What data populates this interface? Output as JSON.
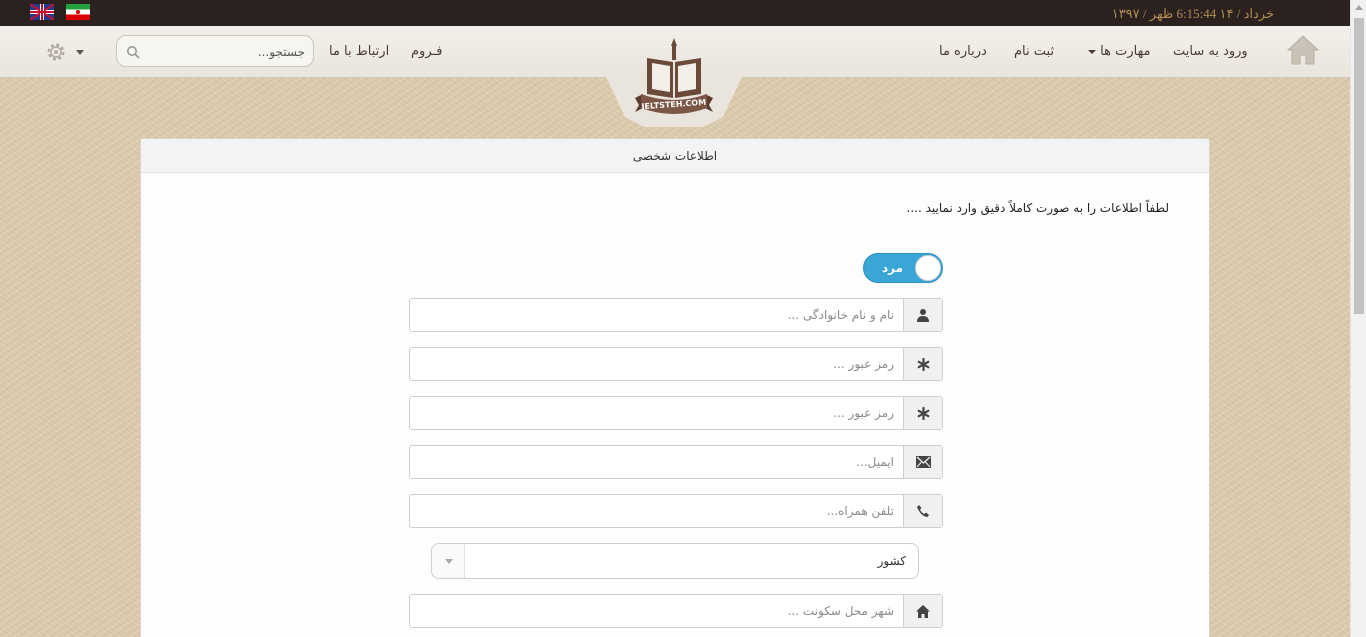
{
  "topbar": {
    "time": "6:15:44 ظهر",
    "date": "۱۳۹۷ / خرداد / ۱۴",
    "flags": [
      "uk-flag-icon",
      "iran-flag-icon"
    ]
  },
  "nav": {
    "home_icon": "home-icon",
    "items": {
      "login": "ورود به سایت",
      "skills": "مهارت ها",
      "register": "ثبت نام",
      "about": "درباره ما",
      "forum": "فـروم",
      "contact": "ارتباط با ما"
    },
    "search_placeholder": "جستجو...",
    "logo_text": "IELTSTEH.COM"
  },
  "panel": {
    "title": "اطلاعات شخصی",
    "intro": "لطفاً اطلاعات را به صورت کاملاً دقیق وارد نمایید ....",
    "gender_toggle": "مرد",
    "fields": {
      "fullname_placeholder": "نام و نام خانوادگی ...",
      "password_placeholder": "رمز عبور ...",
      "password_confirm_placeholder": "رمز عبور ...",
      "email_placeholder": "ایمیل...",
      "phone_placeholder": "تلفن همراه...",
      "country_select": "کشور",
      "city_placeholder": "شهر محل سکونت ..."
    }
  },
  "colors": {
    "topbar": "#2b2220",
    "accent": "#3aa6d6",
    "clock": "#b18c55",
    "background": "#dbcaac"
  }
}
